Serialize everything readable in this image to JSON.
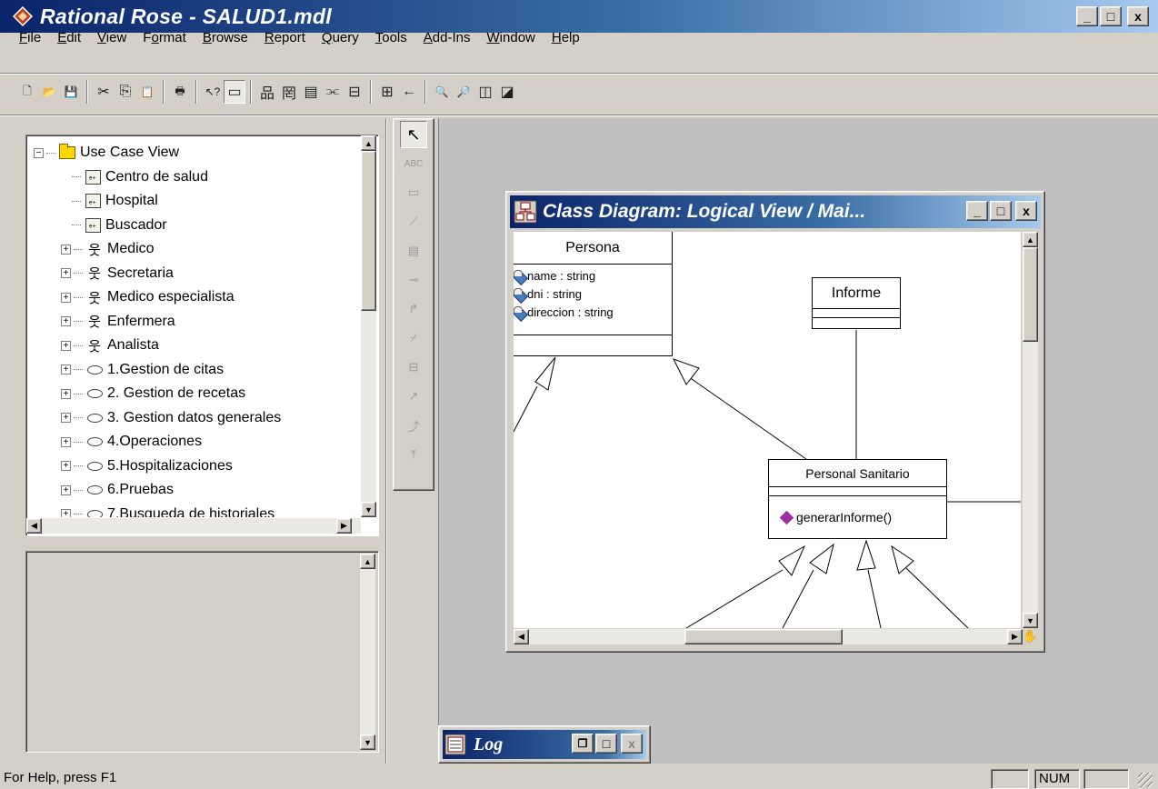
{
  "app": {
    "title": "Rational Rose - SALUD1.mdl",
    "window_buttons": [
      "_",
      "□",
      "x"
    ]
  },
  "menu": [
    {
      "label": "File",
      "ul": "F",
      "rest": "ile"
    },
    {
      "label": "Edit",
      "ul": "E",
      "rest": "dit"
    },
    {
      "label": "View",
      "ul": "V",
      "rest": "iew"
    },
    {
      "label": "Format",
      "ul": "o",
      "pre": "F",
      "rest": "rmat"
    },
    {
      "label": "Browse",
      "ul": "B",
      "rest": "rowse"
    },
    {
      "label": "Report",
      "ul": "R",
      "rest": "eport"
    },
    {
      "label": "Query",
      "ul": "Q",
      "rest": "uery"
    },
    {
      "label": "Tools",
      "ul": "T",
      "rest": "ools"
    },
    {
      "label": "Add-Ins",
      "ul": "A",
      "rest": "dd-Ins"
    },
    {
      "label": "Window",
      "ul": "W",
      "rest": "indow"
    },
    {
      "label": "Help",
      "ul": "H",
      "rest": "elp"
    }
  ],
  "toolbar": [
    {
      "name": "new-icon",
      "glyph": "🗋"
    },
    {
      "name": "open-icon",
      "glyph": "📂"
    },
    {
      "name": "save-icon",
      "glyph": "💾"
    },
    {
      "sep": true
    },
    {
      "name": "cut-icon",
      "glyph": "✂"
    },
    {
      "name": "copy-icon",
      "glyph": "⎘"
    },
    {
      "name": "paste-icon",
      "glyph": "📋"
    },
    {
      "sep": true
    },
    {
      "name": "print-icon",
      "glyph": "🖶"
    },
    {
      "sep": true
    },
    {
      "name": "context-help-icon",
      "glyph": "↖?"
    },
    {
      "name": "view-doc-icon",
      "glyph": "▭",
      "active": true
    },
    {
      "sep": true
    },
    {
      "name": "browse-class-icon",
      "glyph": "品"
    },
    {
      "name": "browse-interaction-icon",
      "glyph": "罔"
    },
    {
      "name": "browse-component-icon",
      "glyph": "▤"
    },
    {
      "name": "browse-deployment-icon",
      "glyph": "⫘"
    },
    {
      "name": "browse-parent-icon",
      "glyph": "⊟"
    },
    {
      "sep": true
    },
    {
      "name": "browse-spec-icon",
      "glyph": "⊞"
    },
    {
      "name": "previous-diagram-icon",
      "glyph": "←"
    },
    {
      "sep": true
    },
    {
      "name": "zoom-in-icon",
      "glyph": "🔍"
    },
    {
      "name": "zoom-out-icon",
      "glyph": "🔎"
    },
    {
      "name": "fit-window-icon",
      "glyph": "◫"
    },
    {
      "name": "undo-fit-icon",
      "glyph": "◪"
    }
  ],
  "tree": [
    {
      "label": "Use Case View",
      "indent": 0,
      "exp": "−",
      "icon": "folder"
    },
    {
      "label": "Centro de salud",
      "indent": 1,
      "exp": null,
      "icon": "pkg"
    },
    {
      "label": "Hospital",
      "indent": 1,
      "exp": null,
      "icon": "pkg"
    },
    {
      "label": "Buscador",
      "indent": 1,
      "exp": null,
      "icon": "pkg"
    },
    {
      "label": "Medico",
      "indent": 1,
      "exp": "+",
      "icon": "actor"
    },
    {
      "label": "Secretaria",
      "indent": 1,
      "exp": "+",
      "icon": "actor"
    },
    {
      "label": "Medico especialista",
      "indent": 1,
      "exp": "+",
      "icon": "actor"
    },
    {
      "label": "Enfermera",
      "indent": 1,
      "exp": "+",
      "icon": "actor"
    },
    {
      "label": "Analista",
      "indent": 1,
      "exp": "+",
      "icon": "actor"
    },
    {
      "label": "1.Gestion de citas",
      "indent": 1,
      "exp": "+",
      "icon": "usecase"
    },
    {
      "label": "2. Gestion de recetas",
      "indent": 1,
      "exp": "+",
      "icon": "usecase"
    },
    {
      "label": "3. Gestion datos generales",
      "indent": 1,
      "exp": "+",
      "icon": "usecase"
    },
    {
      "label": "4.Operaciones",
      "indent": 1,
      "exp": "+",
      "icon": "usecase"
    },
    {
      "label": "5.Hospitalizaciones",
      "indent": 1,
      "exp": "+",
      "icon": "usecase"
    },
    {
      "label": "6.Pruebas",
      "indent": 1,
      "exp": "+",
      "icon": "usecase"
    },
    {
      "label": "7.Busqueda de historiales",
      "indent": 1,
      "exp": "+",
      "icon": "usecase"
    }
  ],
  "toolbox": [
    {
      "name": "selection-tool-icon",
      "glyph": "↖",
      "sel": true
    },
    {
      "name": "text-tool-icon",
      "glyph": "ABC"
    },
    {
      "name": "note-tool-icon",
      "glyph": "▭"
    },
    {
      "name": "anchor-tool-icon",
      "glyph": "⟋"
    },
    {
      "name": "class-tool-icon",
      "glyph": "▤"
    },
    {
      "name": "interface-tool-icon",
      "glyph": "⊸"
    },
    {
      "name": "association-tool-icon",
      "glyph": "↱"
    },
    {
      "name": "aggregation-tool-icon",
      "glyph": "⌿"
    },
    {
      "name": "package-tool-icon",
      "glyph": "⊟"
    },
    {
      "name": "dependency-tool-icon",
      "glyph": "↗"
    },
    {
      "name": "generalization-tool-icon",
      "glyph": "⤴"
    },
    {
      "name": "realize-tool-icon",
      "glyph": "⤒"
    }
  ],
  "diagram": {
    "title": "Class Diagram: Logical View / Mai...",
    "classes": {
      "persona": {
        "name": "Persona",
        "attributes": [
          "name : string",
          "dni : string",
          "direccion : string"
        ]
      },
      "informe": {
        "name": "Informe"
      },
      "personal_sanitario": {
        "name": "Personal Sanitario",
        "operations": [
          "generarInforme()"
        ]
      }
    }
  },
  "log": {
    "title": "Log"
  },
  "status": {
    "text": "For Help, press F1",
    "num": "NUM"
  }
}
